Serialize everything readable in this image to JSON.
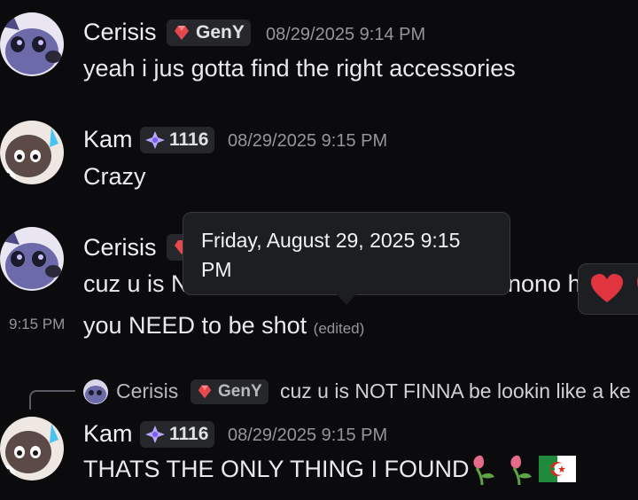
{
  "colors": {
    "background": "#0b0b0d",
    "tag_bg": "#26272b",
    "muted": "#94969c",
    "tooltip_bg": "#1d1e22",
    "heart": "#e0343f"
  },
  "messages": [
    {
      "author": "Cerisis",
      "tag": "GenY",
      "tag_icon": "red-gem-icon",
      "timestamp": "08/29/2025 9:14 PM",
      "lines": [
        "yeah i jus gotta find the right accessories"
      ]
    },
    {
      "author": "Kam",
      "tag": "1116",
      "tag_icon": "purple-star-icon",
      "timestamp": "08/29/2025 9:15 PM",
      "lines": [
        "Crazy"
      ]
    },
    {
      "author": "Cerisis",
      "partial_text_left": "cuz u is N",
      "partial_text_right": "nono h",
      "followup_time": "9:15 PM",
      "followup_text": "you NEED to be shot",
      "edited_label": "(edited)"
    },
    {
      "reply": {
        "author": "Cerisis",
        "tag": "GenY",
        "text": "cuz u is NOT FINNA be lookin like a ke"
      },
      "author": "Kam",
      "tag": "1116",
      "timestamp": "08/29/2025 9:15 PM",
      "lines": [
        "THATS THE ONLY THING I FOUND"
      ],
      "emojis": [
        "wilted-flower-icon",
        "wilted-flower-icon",
        "algeria-flag-icon"
      ]
    }
  ],
  "tooltip": {
    "text": "Friday, August 29, 2025 9:15 PM"
  },
  "reaction_bar": {
    "icons": [
      "heart-icon"
    ]
  }
}
